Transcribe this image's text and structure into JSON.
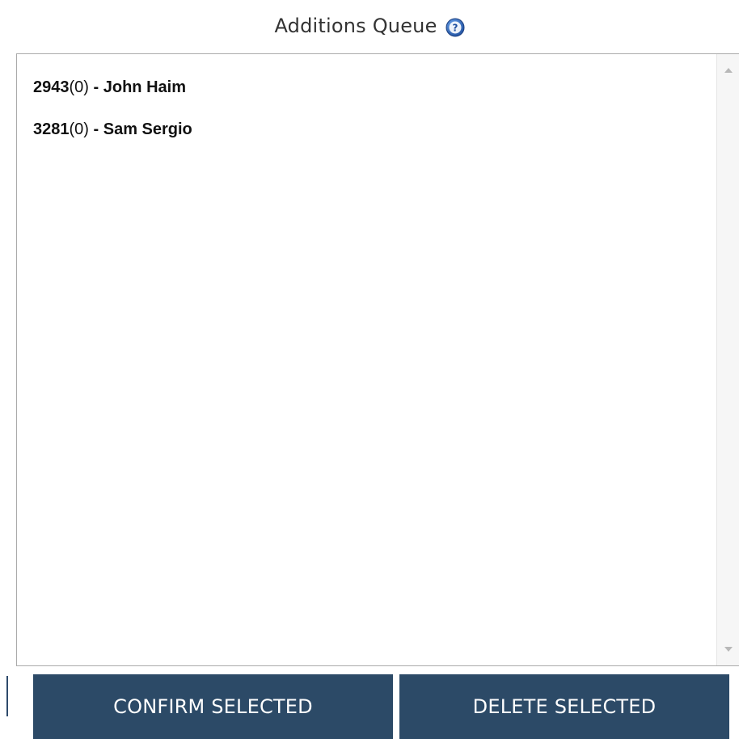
{
  "header": {
    "title": "Additions Queue",
    "help_icon": "help-icon"
  },
  "queue": {
    "items": [
      {
        "id": "2943",
        "count": "(0)",
        "separator": " - ",
        "name": "John Haim"
      },
      {
        "id": "3281",
        "count": "(0)",
        "separator": " - ",
        "name": "Sam Sergio"
      }
    ]
  },
  "buttons": {
    "confirm_label": "CONFIRM SELECTED",
    "delete_label": "DELETE SELECTED"
  },
  "colors": {
    "button_bg": "#2c4a67",
    "button_text": "#ffffff",
    "help_icon": "#1f5fae"
  }
}
